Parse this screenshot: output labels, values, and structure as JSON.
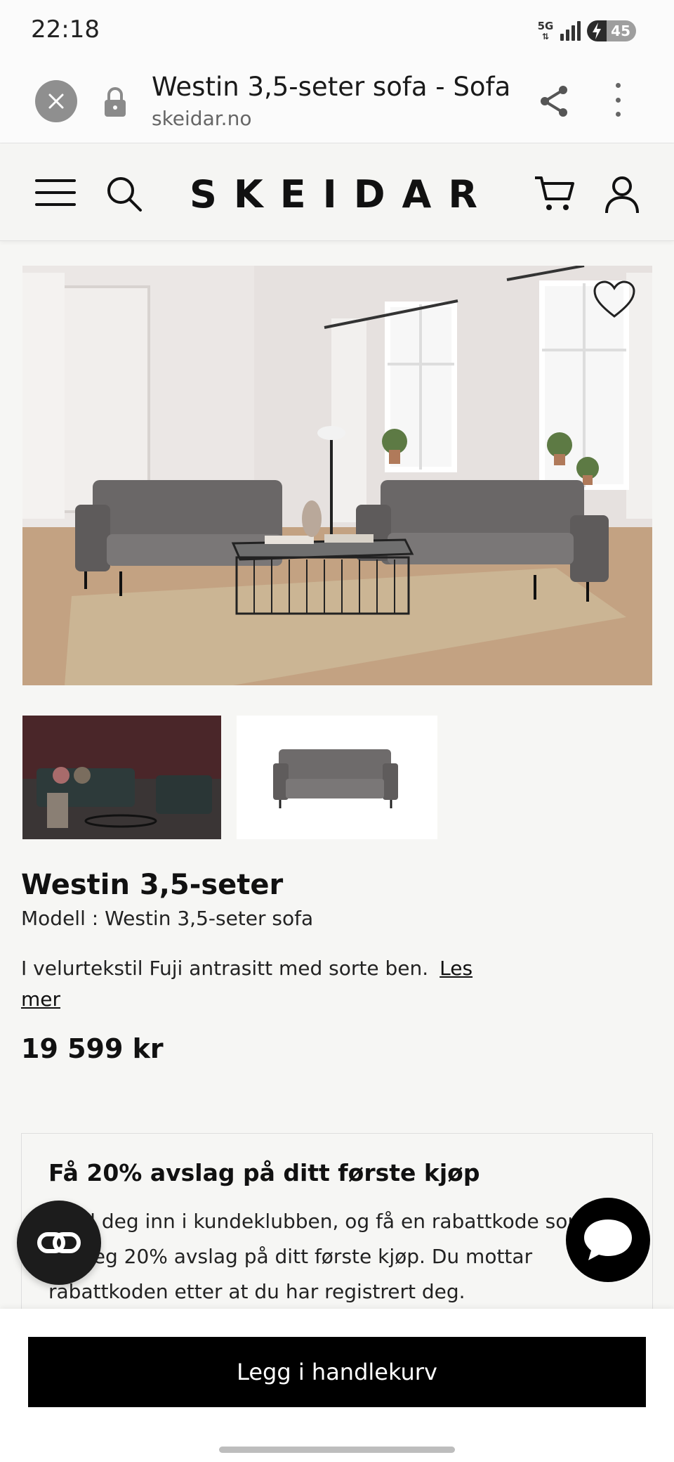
{
  "status_bar": {
    "time": "22:18",
    "network": "5G",
    "battery_percent": "45"
  },
  "browser": {
    "page_title": "Westin 3,5-seter sofa - Sofa",
    "url": "skeidar.no",
    "icons": [
      "close-icon",
      "lock-icon",
      "share-icon",
      "more-vertical-icon"
    ]
  },
  "site_header": {
    "logo": "SKEIDAR",
    "icons": [
      "menu-icon",
      "search-icon",
      "cart-icon",
      "user-icon"
    ]
  },
  "gallery": {
    "main_image": "living room with two grey sofas, glass coffee table, rug",
    "thumbnails": [
      "dark red room with sofa set",
      "grey sofa on white background"
    ],
    "favorite_icon": "heart-icon"
  },
  "product": {
    "name": "Westin 3,5-seter",
    "model_label": "Modell :",
    "model_value": "Westin 3,5-seter sofa",
    "description": "I velurtekstil Fuji antrasitt med sorte ben.",
    "read_more": "Les mer",
    "price": "19 599 kr"
  },
  "promo": {
    "title": "Få 20% avslag på ditt første kjøp",
    "text": "Meld deg inn i kundeklubben, og få en rabattkode som gir deg 20% avslag på ditt første kjøp. Du mottar rabattkoden etter at du har registrert deg."
  },
  "actions": {
    "add_to_cart": "Legg i handlekurv"
  },
  "colors": {
    "background": "#f6f6f4",
    "button": "#000000",
    "button_text": "#ffffff"
  }
}
